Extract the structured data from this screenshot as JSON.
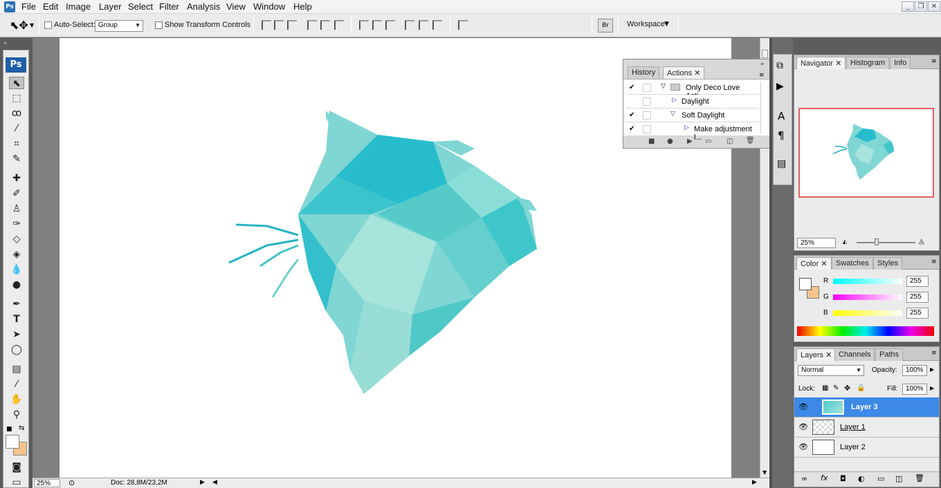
{
  "menubar": {
    "app_icon": "Ps",
    "items": [
      "File",
      "Edit",
      "Image",
      "Layer",
      "Select",
      "Filter",
      "Analysis",
      "View",
      "Window",
      "Help"
    ]
  },
  "options_bar": {
    "auto_select_label": "Auto-Select:",
    "auto_select_value": "Group",
    "transform_label": "Show Transform Controls",
    "workspace_label": "Workspace"
  },
  "tools_panel": {
    "logo": "Ps"
  },
  "status_bar": {
    "zoom": "25%",
    "doc_info": "Doc: 28,8M/23,2M"
  },
  "actions_panel": {
    "tabs": [
      "History",
      "Actions"
    ],
    "active_tab": "Actions",
    "rows": [
      {
        "label": "Only Deco Love Acti...",
        "checked": true
      },
      {
        "label": "Daylight",
        "checked": false
      },
      {
        "label": "Soft Daylight",
        "checked": true
      },
      {
        "label": "Make adjustment l...",
        "checked": true
      }
    ]
  },
  "navigator_panel": {
    "tabs": [
      "Navigator",
      "Histogram",
      "Info"
    ],
    "active_tab": "Navigator",
    "zoom": "25%"
  },
  "color_panel": {
    "tabs": [
      "Color",
      "Swatches",
      "Styles"
    ],
    "active_tab": "Color",
    "channels": [
      {
        "label": "R",
        "value": "255"
      },
      {
        "label": "G",
        "value": "255"
      },
      {
        "label": "B",
        "value": "255"
      }
    ],
    "foreground_color": "#ffffff",
    "background_color": "#f6c38c"
  },
  "layers_panel": {
    "tabs": [
      "Layers",
      "Channels",
      "Paths"
    ],
    "active_tab": "Layers",
    "blend_mode": "Normal",
    "opacity_label": "Opacity:",
    "opacity_value": "100%",
    "lock_label": "Lock:",
    "fill_label": "Fill:",
    "fill_value": "100%",
    "layers": [
      {
        "name": "Layer 3",
        "selected": true
      },
      {
        "name": "Layer 1",
        "selected": false
      },
      {
        "name": "Layer 2",
        "selected": false
      }
    ]
  },
  "accent_colors": {
    "selection_blue": "#3c89e8",
    "cat_teal": "#4cc9cc"
  }
}
